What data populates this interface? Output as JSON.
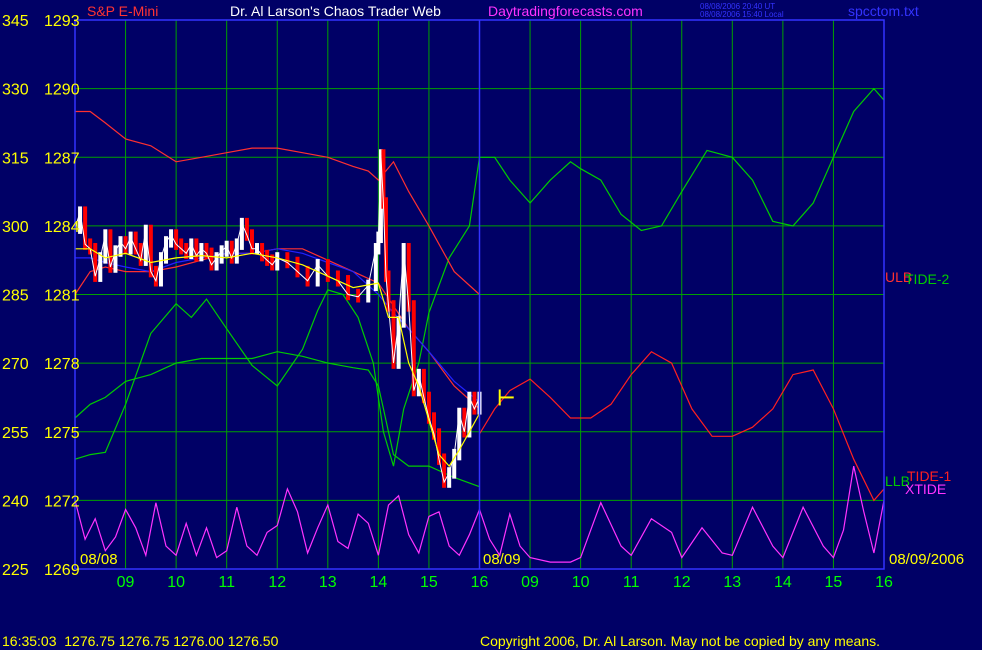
{
  "header": {
    "instrument": "S&P E-Mini",
    "site_title": "Dr. Al Larson's Chaos Trader Web",
    "site_link": "Daytradingforecasts.com",
    "timestamp_ut": "08/08/2006 20:40 UT",
    "timestamp_local": "08/08/2006 15:40 Local",
    "file_name": "spcctom.txt"
  },
  "footer": {
    "quote": "16:35:03  1276.75 1276.75 1276.00 1276.50",
    "copyright": "Copyright 2006, Dr. Al Larson. May not be copied by any means."
  },
  "colors": {
    "background": "#000066",
    "grid": "#00a000",
    "axis_text": "#ffff00",
    "time_axis_text": "#00ff00",
    "instrument": "#ff3333",
    "title": "#ffffff",
    "link": "#ff33ff",
    "file": "#3333ff",
    "divider": "#3333ff",
    "tide1": "#ff2020",
    "tide2": "#00cc00",
    "xtide": "#ff33ff",
    "price_up": "#ffffff",
    "price_down": "#ff0000",
    "avg": "#ffff00",
    "channel": "#ff3030",
    "blue_avg": "#2222ff"
  },
  "chart_data": {
    "type": "line",
    "y_left_labels": [
      "345",
      "330",
      "315",
      "300",
      "285",
      "270",
      "255",
      "240",
      "225"
    ],
    "y_price_labels": [
      "1293",
      "1290",
      "1287",
      "1284",
      "1281",
      "1278",
      "1275",
      "1272",
      "1269"
    ],
    "ylim": [
      1269,
      1293
    ],
    "x_ticks": [
      "09",
      "10",
      "11",
      "12",
      "13",
      "14",
      "15",
      "16",
      "09",
      "10",
      "11",
      "12",
      "13",
      "14",
      "15",
      "16"
    ],
    "x_date_labels": [
      "08/08",
      "08/09",
      "08/09/2006"
    ],
    "series_labels": {
      "ulb": "ULB",
      "tide2": "TIDE-2",
      "llb": "LLB",
      "tide1": "TIDE-1",
      "xtide": "XTIDE"
    },
    "series": [
      {
        "name": "TIDE-2",
        "x": [
          8.0,
          8.3,
          8.6,
          9.0,
          9.5,
          10.0,
          10.3,
          10.6,
          11.0,
          11.5,
          12.0,
          12.5,
          12.8,
          13.0,
          13.3,
          13.6,
          13.9,
          14.1,
          14.3,
          14.5,
          14.8,
          15.0,
          15.4,
          15.8,
          16.0,
          16.3,
          16.6,
          17.0,
          17.4,
          17.8,
          18.0,
          18.4,
          18.8,
          19.2,
          19.6,
          20.0,
          20.5,
          21.0,
          21.4,
          21.8,
          22.2,
          22.6,
          23.0,
          23.4,
          23.8,
          24.0
        ],
        "values": [
          1273.8,
          1274.0,
          1274.1,
          1276.2,
          1279.3,
          1280.6,
          1280.0,
          1280.8,
          1279.5,
          1277.9,
          1277.0,
          1278.6,
          1280.3,
          1281.2,
          1281.0,
          1280.0,
          1278.0,
          1275.0,
          1273.5,
          1276.0,
          1278.0,
          1280.2,
          1282.6,
          1284.0,
          1287.0,
          1287.0,
          1286.0,
          1285.0,
          1286.0,
          1286.8,
          1286.5,
          1286.0,
          1284.5,
          1283.8,
          1284.0,
          1285.5,
          1287.3,
          1287.0,
          1286.0,
          1284.2,
          1284.0,
          1285.0,
          1287.0,
          1289.0,
          1290.0,
          1289.5
        ]
      },
      {
        "name": "TIDE-1",
        "x": [
          16.0,
          16.3,
          16.6,
          17.0,
          17.4,
          17.8,
          18.2,
          18.6,
          19.0,
          19.4,
          19.8,
          20.2,
          20.6,
          21.0,
          21.4,
          21.8,
          22.2,
          22.6,
          23.0,
          23.4,
          23.8,
          24.0
        ],
        "values": [
          1274.9,
          1276.0,
          1276.8,
          1277.3,
          1276.5,
          1275.6,
          1275.6,
          1276.2,
          1277.5,
          1278.5,
          1278.0,
          1276.0,
          1274.8,
          1274.8,
          1275.2,
          1276.0,
          1277.5,
          1277.7,
          1276.0,
          1273.8,
          1272.0,
          1272.5
        ]
      },
      {
        "name": "XTIDE",
        "x": [
          8.0,
          8.2,
          8.4,
          8.6,
          8.8,
          9.0,
          9.2,
          9.4,
          9.6,
          9.8,
          10.0,
          10.2,
          10.4,
          10.6,
          10.8,
          11.0,
          11.2,
          11.4,
          11.6,
          11.8,
          12.0,
          12.2,
          12.4,
          12.6,
          12.8,
          13.0,
          13.2,
          13.4,
          13.6,
          13.8,
          14.0,
          14.2,
          14.4,
          14.6,
          14.8,
          15.0,
          15.2,
          15.4,
          15.6,
          15.8,
          16.0,
          16.2,
          16.4,
          16.6,
          16.8,
          17.0,
          17.4,
          17.8,
          18.0,
          18.4,
          18.8,
          19.0,
          19.4,
          19.8,
          20.0,
          20.4,
          20.8,
          21.0,
          21.4,
          21.8,
          22.0,
          22.4,
          22.8,
          23.0,
          23.2,
          23.4,
          23.6,
          23.8,
          24.0
        ],
        "values": [
          1272.0,
          1270.3,
          1271.2,
          1269.8,
          1270.4,
          1271.6,
          1270.8,
          1269.6,
          1271.9,
          1270.0,
          1269.6,
          1271.0,
          1269.6,
          1270.8,
          1269.5,
          1269.8,
          1271.7,
          1270.0,
          1269.6,
          1270.6,
          1270.9,
          1272.5,
          1271.5,
          1269.7,
          1270.8,
          1271.8,
          1270.2,
          1269.9,
          1271.4,
          1271.0,
          1269.6,
          1271.8,
          1272.2,
          1270.5,
          1269.7,
          1271.3,
          1271.5,
          1270.0,
          1269.6,
          1270.5,
          1271.6,
          1270.3,
          1269.6,
          1271.4,
          1270.0,
          1269.5,
          1269.3,
          1269.3,
          1269.5,
          1271.9,
          1270.0,
          1269.6,
          1271.2,
          1270.6,
          1269.5,
          1270.8,
          1269.7,
          1269.6,
          1271.7,
          1270.0,
          1269.5,
          1271.7,
          1270.0,
          1269.5,
          1270.7,
          1273.5,
          1271.5,
          1269.7,
          1272.0
        ]
      },
      {
        "name": "ULB",
        "x": [
          8.0,
          8.3,
          8.6,
          9.0,
          9.5,
          10.0,
          10.5,
          11.0,
          11.5,
          12.0,
          12.5,
          13.0,
          13.5,
          13.8,
          14.0,
          14.3,
          14.6,
          15.0,
          15.5,
          16.0
        ],
        "values": [
          1289.0,
          1289.0,
          1288.5,
          1287.8,
          1287.5,
          1286.8,
          1287.0,
          1287.2,
          1287.4,
          1287.4,
          1287.2,
          1287.0,
          1286.6,
          1286.4,
          1286.0,
          1286.8,
          1285.5,
          1284.0,
          1282.0,
          1281.0
        ]
      },
      {
        "name": "LLB",
        "x": [
          8.0,
          8.3,
          8.6,
          9.0,
          9.5,
          10.0,
          10.5,
          11.0,
          11.5,
          12.0,
          12.5,
          13.0,
          13.5,
          13.8,
          14.0,
          14.3,
          14.6,
          15.0,
          15.5,
          16.0
        ],
        "values": [
          1275.6,
          1276.2,
          1276.5,
          1277.2,
          1277.5,
          1278.0,
          1278.2,
          1278.2,
          1278.2,
          1278.5,
          1278.3,
          1278.0,
          1277.8,
          1277.7,
          1277.0,
          1274.0,
          1273.5,
          1273.5,
          1273.0,
          1272.6
        ]
      },
      {
        "name": "Mid",
        "x": [
          8.0,
          8.3,
          8.6,
          9.0,
          9.5,
          10.0,
          10.5,
          11.0,
          11.5,
          12.0,
          12.5,
          13.0,
          13.5,
          14.0,
          14.3,
          14.6,
          15.0,
          15.5,
          16.0
        ],
        "values": [
          1281.0,
          1282.0,
          1282.2,
          1282.0,
          1282.0,
          1282.2,
          1282.5,
          1282.8,
          1282.8,
          1283.0,
          1283.0,
          1282.5,
          1282.0,
          1281.5,
          1280.5,
          1279.5,
          1278.5,
          1277.0,
          1276.0
        ]
      },
      {
        "name": "Price",
        "x": [
          8.0,
          8.1,
          8.2,
          8.3,
          8.4,
          8.5,
          8.6,
          8.7,
          8.8,
          8.9,
          9.0,
          9.1,
          9.2,
          9.3,
          9.4,
          9.5,
          9.6,
          9.7,
          9.8,
          9.9,
          10.0,
          10.1,
          10.2,
          10.3,
          10.4,
          10.5,
          10.6,
          10.7,
          10.8,
          10.9,
          11.0,
          11.1,
          11.2,
          11.3,
          11.4,
          11.5,
          11.6,
          11.7,
          11.8,
          11.9,
          12.0,
          12.2,
          12.4,
          12.6,
          12.8,
          13.0,
          13.2,
          13.4,
          13.6,
          13.8,
          13.95,
          14.0,
          14.05,
          14.1,
          14.15,
          14.2,
          14.3,
          14.4,
          14.5,
          14.6,
          14.7,
          14.8,
          14.9,
          15.0,
          15.1,
          15.2,
          15.3,
          15.4,
          15.5,
          15.6,
          15.7,
          15.8,
          15.9,
          16.0
        ],
        "values": [
          1283.9,
          1284.6,
          1283.2,
          1283.0,
          1281.8,
          1282.6,
          1283.6,
          1282.2,
          1282.9,
          1283.3,
          1283.0,
          1283.5,
          1283.0,
          1282.5,
          1283.8,
          1282.0,
          1281.6,
          1282.6,
          1283.3,
          1283.6,
          1283.2,
          1283.0,
          1282.8,
          1283.2,
          1282.7,
          1283.0,
          1282.8,
          1282.3,
          1282.6,
          1282.9,
          1283.1,
          1282.6,
          1283.2,
          1284.1,
          1283.6,
          1283.0,
          1283.0,
          1282.7,
          1282.5,
          1282.3,
          1282.6,
          1282.4,
          1282.0,
          1281.6,
          1282.3,
          1281.8,
          1281.6,
          1281.0,
          1280.9,
          1281.4,
          1283.0,
          1283.5,
          1287.1,
          1285.0,
          1281.8,
          1280.5,
          1278.0,
          1279.8,
          1283.0,
          1280.5,
          1276.8,
          1277.5,
          1276.5,
          1275.6,
          1274.9,
          1273.8,
          1272.8,
          1273.2,
          1274.0,
          1275.8,
          1275.0,
          1276.5,
          1276.0,
          1276.5
        ]
      },
      {
        "name": "Avg",
        "x": [
          8.0,
          8.3,
          8.6,
          9.0,
          9.5,
          10.0,
          10.5,
          11.0,
          11.5,
          12.0,
          12.5,
          13.0,
          13.5,
          14.0,
          14.2,
          14.4,
          14.6,
          14.8,
          15.0,
          15.2,
          15.4,
          15.6,
          15.8,
          16.0
        ],
        "values": [
          1283.0,
          1283.0,
          1282.6,
          1282.8,
          1282.4,
          1282.6,
          1282.7,
          1282.6,
          1282.8,
          1282.6,
          1282.3,
          1281.8,
          1281.3,
          1281.5,
          1280.0,
          1280.0,
          1278.0,
          1277.0,
          1275.5,
          1274.0,
          1273.5,
          1274.2,
          1275.0,
          1275.8
        ]
      },
      {
        "name": "Blue",
        "x": [
          8.0,
          8.3,
          8.6,
          9.0,
          9.5,
          10.0,
          10.5,
          11.0,
          11.5,
          12.0,
          12.5,
          13.0,
          13.5,
          14.0,
          14.3,
          14.6,
          15.0,
          15.5,
          16.0
        ],
        "values": [
          1282.6,
          1282.6,
          1282.4,
          1282.2,
          1282.0,
          1282.4,
          1282.6,
          1282.8,
          1282.8,
          1283.0,
          1282.8,
          1282.4,
          1282.0,
          1281.0,
          1280.2,
          1279.5,
          1278.5,
          1277.2,
          1276.3
        ]
      }
    ],
    "xlim": [
      8,
      24
    ],
    "grid": true
  }
}
